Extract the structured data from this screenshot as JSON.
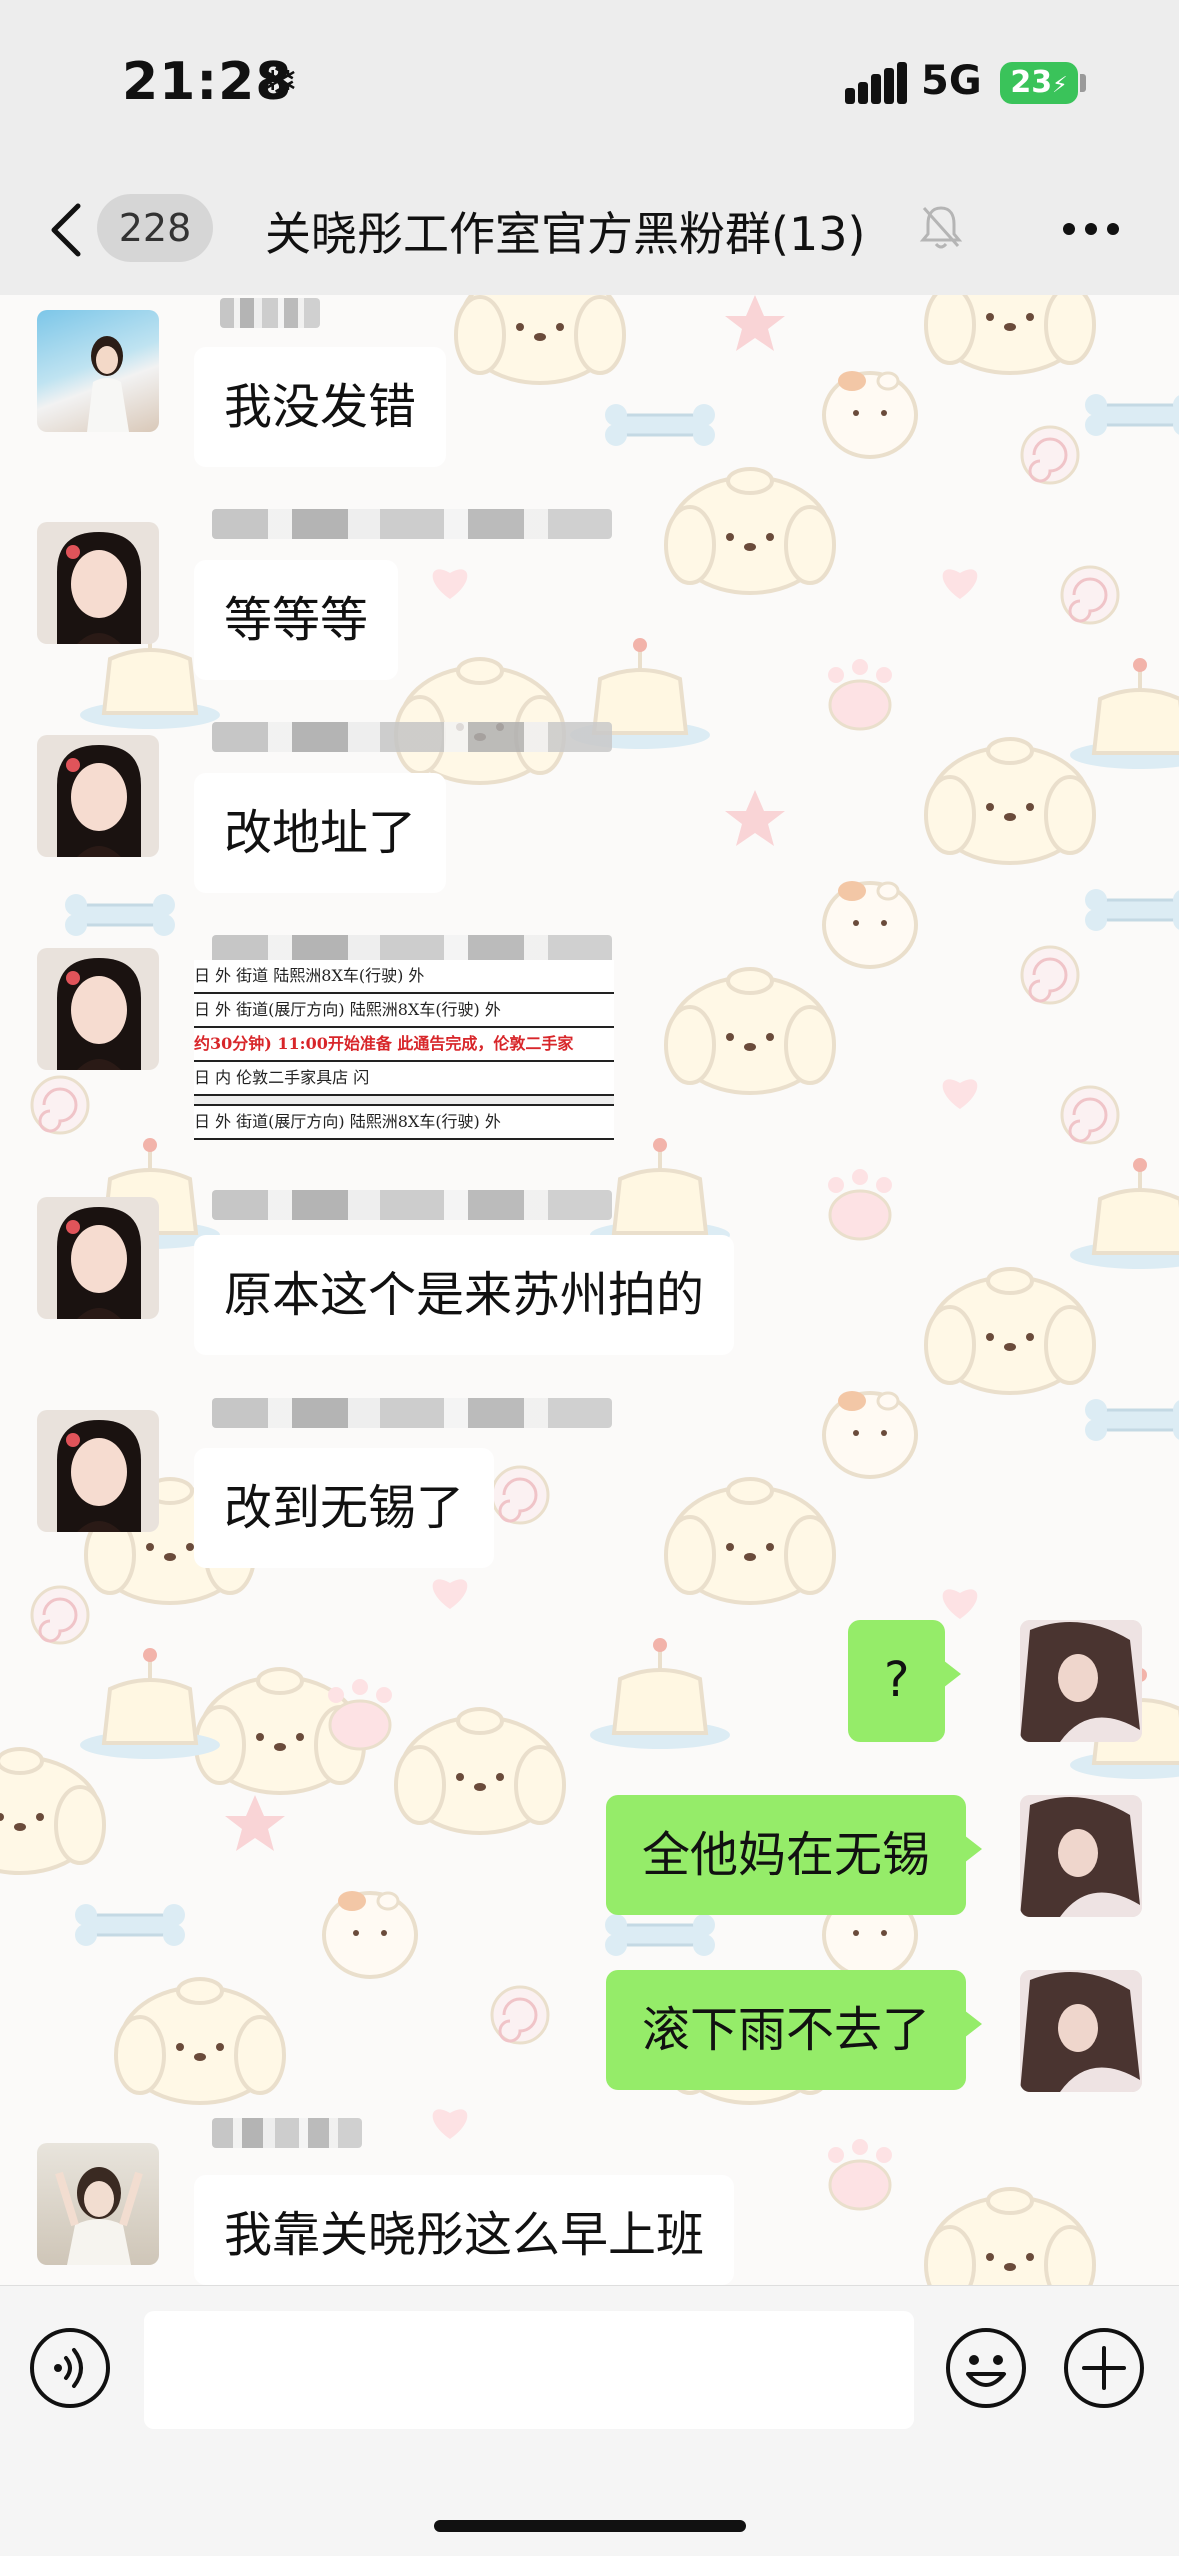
{
  "status_bar": {
    "time": "21:28",
    "snow_glyph": "❄",
    "network": "5G",
    "battery": "23"
  },
  "nav": {
    "unread_count": "228",
    "title": "关晓彤工作室官方黑粉群(13)"
  },
  "messages": [
    {
      "side": "in",
      "text": "我没发错"
    },
    {
      "side": "in",
      "text": "等等等"
    },
    {
      "side": "in",
      "text": "改地址了"
    },
    {
      "side": "in",
      "type": "image"
    },
    {
      "side": "in",
      "text": "原本这个是来苏州拍的"
    },
    {
      "side": "in",
      "text": "改到无锡了"
    },
    {
      "side": "out",
      "text": "?"
    },
    {
      "side": "out",
      "text": "全他妈在无锡"
    },
    {
      "side": "out",
      "text": "滚下雨不去了"
    },
    {
      "side": "in",
      "text": "我靠关晓彤这么早上班"
    }
  ],
  "schedule_image": {
    "rows": [
      "日  外  街道                    陆熙洲8X车(行驶)        外",
      "日  外  街道(展厅方向)          陆熙洲8X车(行驶)        外",
      "约30分钟) 11:00开始准备       此通告完成，伦敦二手家",
      "日  内  伦敦二手家具店                                  闪",
      "",
      "日  外  街道(展厅方向)          陆熙洲8X车(行驶)        外"
    ]
  },
  "input_bar": {
    "placeholder": ""
  },
  "colors": {
    "outgoing_bubble": "#95ec69",
    "incoming_bubble": "#ffffff",
    "battery": "#3ac35a",
    "background": "#ededed"
  },
  "icons": {
    "back": "back-chevron-icon",
    "mute": "bell-muted-icon",
    "more": "more-dots-icon",
    "voice": "voice-icon",
    "emoji": "emoji-icon",
    "plus": "plus-icon"
  }
}
